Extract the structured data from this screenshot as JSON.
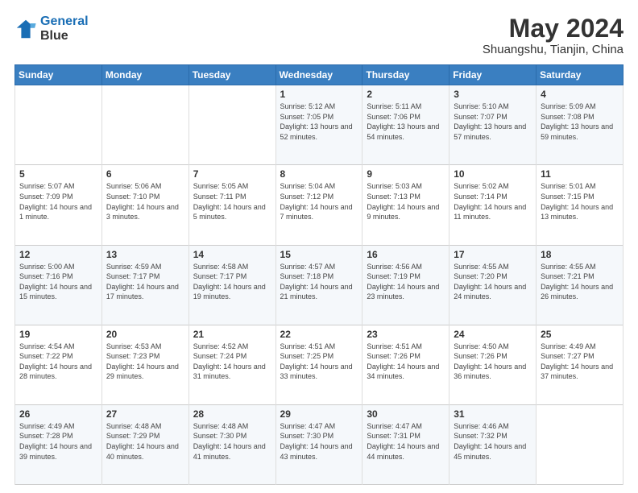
{
  "header": {
    "logo_line1": "General",
    "logo_line2": "Blue",
    "main_title": "May 2024",
    "subtitle": "Shuangshu, Tianjin, China"
  },
  "weekdays": [
    "Sunday",
    "Monday",
    "Tuesday",
    "Wednesday",
    "Thursday",
    "Friday",
    "Saturday"
  ],
  "weeks": [
    [
      {
        "day": "",
        "info": ""
      },
      {
        "day": "",
        "info": ""
      },
      {
        "day": "",
        "info": ""
      },
      {
        "day": "1",
        "info": "Sunrise: 5:12 AM\nSunset: 7:05 PM\nDaylight: 13 hours and 52 minutes."
      },
      {
        "day": "2",
        "info": "Sunrise: 5:11 AM\nSunset: 7:06 PM\nDaylight: 13 hours and 54 minutes."
      },
      {
        "day": "3",
        "info": "Sunrise: 5:10 AM\nSunset: 7:07 PM\nDaylight: 13 hours and 57 minutes."
      },
      {
        "day": "4",
        "info": "Sunrise: 5:09 AM\nSunset: 7:08 PM\nDaylight: 13 hours and 59 minutes."
      }
    ],
    [
      {
        "day": "5",
        "info": "Sunrise: 5:07 AM\nSunset: 7:09 PM\nDaylight: 14 hours and 1 minute."
      },
      {
        "day": "6",
        "info": "Sunrise: 5:06 AM\nSunset: 7:10 PM\nDaylight: 14 hours and 3 minutes."
      },
      {
        "day": "7",
        "info": "Sunrise: 5:05 AM\nSunset: 7:11 PM\nDaylight: 14 hours and 5 minutes."
      },
      {
        "day": "8",
        "info": "Sunrise: 5:04 AM\nSunset: 7:12 PM\nDaylight: 14 hours and 7 minutes."
      },
      {
        "day": "9",
        "info": "Sunrise: 5:03 AM\nSunset: 7:13 PM\nDaylight: 14 hours and 9 minutes."
      },
      {
        "day": "10",
        "info": "Sunrise: 5:02 AM\nSunset: 7:14 PM\nDaylight: 14 hours and 11 minutes."
      },
      {
        "day": "11",
        "info": "Sunrise: 5:01 AM\nSunset: 7:15 PM\nDaylight: 14 hours and 13 minutes."
      }
    ],
    [
      {
        "day": "12",
        "info": "Sunrise: 5:00 AM\nSunset: 7:16 PM\nDaylight: 14 hours and 15 minutes."
      },
      {
        "day": "13",
        "info": "Sunrise: 4:59 AM\nSunset: 7:17 PM\nDaylight: 14 hours and 17 minutes."
      },
      {
        "day": "14",
        "info": "Sunrise: 4:58 AM\nSunset: 7:17 PM\nDaylight: 14 hours and 19 minutes."
      },
      {
        "day": "15",
        "info": "Sunrise: 4:57 AM\nSunset: 7:18 PM\nDaylight: 14 hours and 21 minutes."
      },
      {
        "day": "16",
        "info": "Sunrise: 4:56 AM\nSunset: 7:19 PM\nDaylight: 14 hours and 23 minutes."
      },
      {
        "day": "17",
        "info": "Sunrise: 4:55 AM\nSunset: 7:20 PM\nDaylight: 14 hours and 24 minutes."
      },
      {
        "day": "18",
        "info": "Sunrise: 4:55 AM\nSunset: 7:21 PM\nDaylight: 14 hours and 26 minutes."
      }
    ],
    [
      {
        "day": "19",
        "info": "Sunrise: 4:54 AM\nSunset: 7:22 PM\nDaylight: 14 hours and 28 minutes."
      },
      {
        "day": "20",
        "info": "Sunrise: 4:53 AM\nSunset: 7:23 PM\nDaylight: 14 hours and 29 minutes."
      },
      {
        "day": "21",
        "info": "Sunrise: 4:52 AM\nSunset: 7:24 PM\nDaylight: 14 hours and 31 minutes."
      },
      {
        "day": "22",
        "info": "Sunrise: 4:51 AM\nSunset: 7:25 PM\nDaylight: 14 hours and 33 minutes."
      },
      {
        "day": "23",
        "info": "Sunrise: 4:51 AM\nSunset: 7:26 PM\nDaylight: 14 hours and 34 minutes."
      },
      {
        "day": "24",
        "info": "Sunrise: 4:50 AM\nSunset: 7:26 PM\nDaylight: 14 hours and 36 minutes."
      },
      {
        "day": "25",
        "info": "Sunrise: 4:49 AM\nSunset: 7:27 PM\nDaylight: 14 hours and 37 minutes."
      }
    ],
    [
      {
        "day": "26",
        "info": "Sunrise: 4:49 AM\nSunset: 7:28 PM\nDaylight: 14 hours and 39 minutes."
      },
      {
        "day": "27",
        "info": "Sunrise: 4:48 AM\nSunset: 7:29 PM\nDaylight: 14 hours and 40 minutes."
      },
      {
        "day": "28",
        "info": "Sunrise: 4:48 AM\nSunset: 7:30 PM\nDaylight: 14 hours and 41 minutes."
      },
      {
        "day": "29",
        "info": "Sunrise: 4:47 AM\nSunset: 7:30 PM\nDaylight: 14 hours and 43 minutes."
      },
      {
        "day": "30",
        "info": "Sunrise: 4:47 AM\nSunset: 7:31 PM\nDaylight: 14 hours and 44 minutes."
      },
      {
        "day": "31",
        "info": "Sunrise: 4:46 AM\nSunset: 7:32 PM\nDaylight: 14 hours and 45 minutes."
      },
      {
        "day": "",
        "info": ""
      }
    ]
  ]
}
